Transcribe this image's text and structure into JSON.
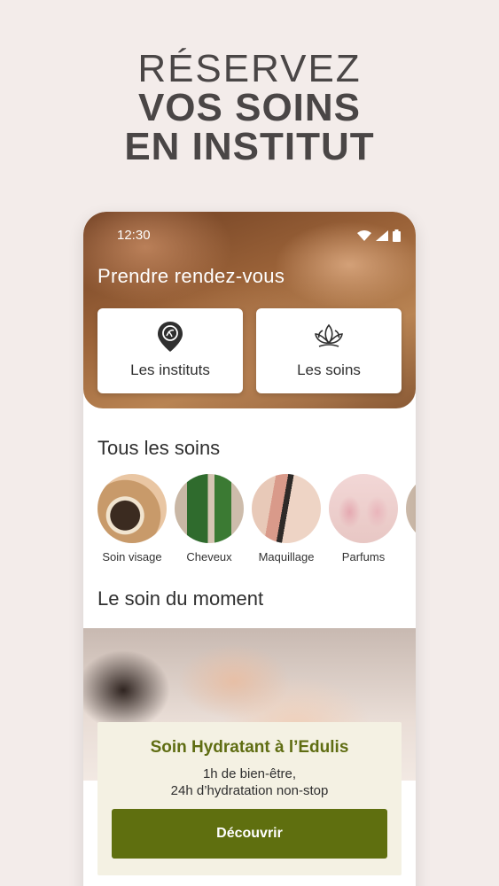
{
  "headline": {
    "line1": "RÉSERVEZ",
    "line2": "VOS SOINS",
    "line3": "EN INSTITUT"
  },
  "status_bar": {
    "time": "12:30"
  },
  "hero": {
    "title": "Prendre rendez-vous"
  },
  "cards": [
    {
      "label": "Les instituts",
      "icon": "location-pin-icon"
    },
    {
      "label": "Les soins",
      "icon": "lotus-icon"
    }
  ],
  "all_soins": {
    "title": "Tous les soins",
    "items": [
      {
        "label": "Soin visage"
      },
      {
        "label": "Cheveux"
      },
      {
        "label": "Maquillage"
      },
      {
        "label": "Parfums"
      }
    ]
  },
  "moment": {
    "title": "Le soin du moment",
    "card_title": "Soin Hydratant à l’Edulis",
    "subtitle_line1": "1h de bien-être,",
    "subtitle_line2": "24h d’hydratation non-stop",
    "button": "Découvrir"
  },
  "colors": {
    "accent": "#5f6f0f",
    "title_green": "#5f6d12",
    "background": "#f3ecea"
  }
}
